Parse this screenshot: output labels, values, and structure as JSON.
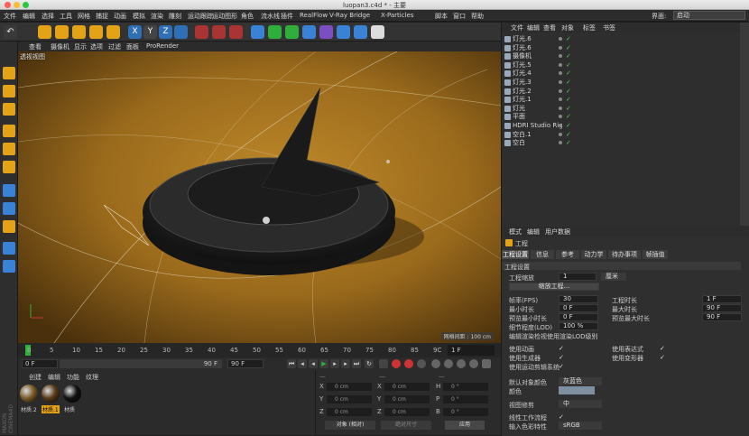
{
  "window": {
    "title": "luopan3.c4d * - 主要"
  },
  "menu": [
    "文件",
    "编辑",
    "选择",
    "工具",
    "网格",
    "捕捉",
    "动画",
    "模拟",
    "渲染",
    "雕刻",
    "运动跟踪",
    "运动图形",
    "角色",
    "流水线",
    "插件",
    "RealFlow",
    "V-Ray Bridge",
    "X-Particles",
    "脚本",
    "窗口",
    "帮助"
  ],
  "interface": {
    "label": "界面:",
    "value": "启动"
  },
  "viewport_menu": [
    "查看",
    "摄像机",
    "显示",
    "选项",
    "过滤",
    "面板",
    "ProRender"
  ],
  "viewport": {
    "label": "透视视图",
    "grid_spacing": "网格间距 : 100 cm"
  },
  "timeline": {
    "ticks": [
      "0",
      "5",
      "10",
      "15",
      "20",
      "25",
      "30",
      "35",
      "40",
      "45",
      "50",
      "55",
      "60",
      "65",
      "70",
      "75",
      "80",
      "85",
      "9C"
    ],
    "current_frame": "1 F"
  },
  "transport": {
    "start": "0 F",
    "min_label": "90 F",
    "end": "90 F",
    "buttons": [
      "|◀",
      "◀◀",
      "◀",
      "▶",
      "▶▶",
      "▶|",
      "↺"
    ]
  },
  "materials": {
    "menu": [
      "创建",
      "编辑",
      "功能",
      "纹理"
    ],
    "items": [
      {
        "name": "材质.2",
        "color": "#7a5a2a"
      },
      {
        "name": "材质.1",
        "color": "#5a3a1a"
      },
      {
        "name": "材质",
        "color": "#111111"
      }
    ]
  },
  "coords": {
    "position": {
      "x": "0 cm",
      "y": "0 cm",
      "z": "0 cm"
    },
    "size": {
      "x": "0 cm",
      "y": "0 cm",
      "z": "0 cm"
    },
    "rotation": {
      "h": "0 °",
      "p": "0 °",
      "b": "0 °"
    },
    "mode": "对象 (相对)",
    "size_mode": "绝对尺寸",
    "apply": "应用"
  },
  "object_manager": {
    "menu": [
      "文件",
      "编辑",
      "查看",
      "对象",
      "标签",
      "书签"
    ],
    "objects": [
      {
        "name": "灯光.6",
        "indent": 0
      },
      {
        "name": "灯光.6",
        "indent": 0
      },
      {
        "name": "摄像机",
        "indent": 0
      },
      {
        "name": "灯光.5",
        "indent": 0
      },
      {
        "name": "灯光.4",
        "indent": 0
      },
      {
        "name": "灯光.3",
        "indent": 0
      },
      {
        "name": "灯光.2",
        "indent": 0
      },
      {
        "name": "灯光.1",
        "indent": 0
      },
      {
        "name": "灯光",
        "indent": 0
      },
      {
        "name": "平面",
        "indent": 0
      },
      {
        "name": "HDRI Studio Rig",
        "indent": 0
      },
      {
        "name": "空白.1",
        "indent": 0
      },
      {
        "name": "空白",
        "indent": 0
      }
    ]
  },
  "attributes": {
    "menu": [
      "模式",
      "编辑",
      "用户数据"
    ],
    "object_label": "工程",
    "tabs": [
      "工程设置",
      "信息",
      "参考",
      "动力学",
      "待办事项",
      "帧插值"
    ],
    "section": "工程设置",
    "project_scale_label": "工程缩放",
    "project_scale_value": "1",
    "project_scale_unit": "厘米",
    "scale_button": "缩放工程...",
    "fields_left": [
      {
        "label": "帧率(FPS)",
        "value": "30"
      },
      {
        "label": "最小时长",
        "value": "0 F"
      },
      {
        "label": "预览最小时长",
        "value": "0 F"
      },
      {
        "label": "细节程度(LOD)",
        "value": "100 %"
      }
    ],
    "fields_right": [
      {
        "label": "工程时长",
        "value": "1 F"
      },
      {
        "label": "最大时长",
        "value": "90 F"
      },
      {
        "label": "预览最大时长",
        "value": "90 F"
      }
    ],
    "lod_render": "编辑渲染检视使用渲染LOD级别",
    "checks_left": [
      "使用动画",
      "使用生成器",
      "使用运动剪辑系统"
    ],
    "checks_right": [
      "使用表达式",
      "使用变形器"
    ],
    "default_color_label": "默认对象颜色",
    "default_color_value": "灰蓝色",
    "color_label": "颜色",
    "view_clip_label": "视图修剪",
    "view_clip_value": "中",
    "linear_label": "线性工作流程",
    "input_color_label": "输入色彩特性",
    "input_color_value": "sRGB"
  }
}
